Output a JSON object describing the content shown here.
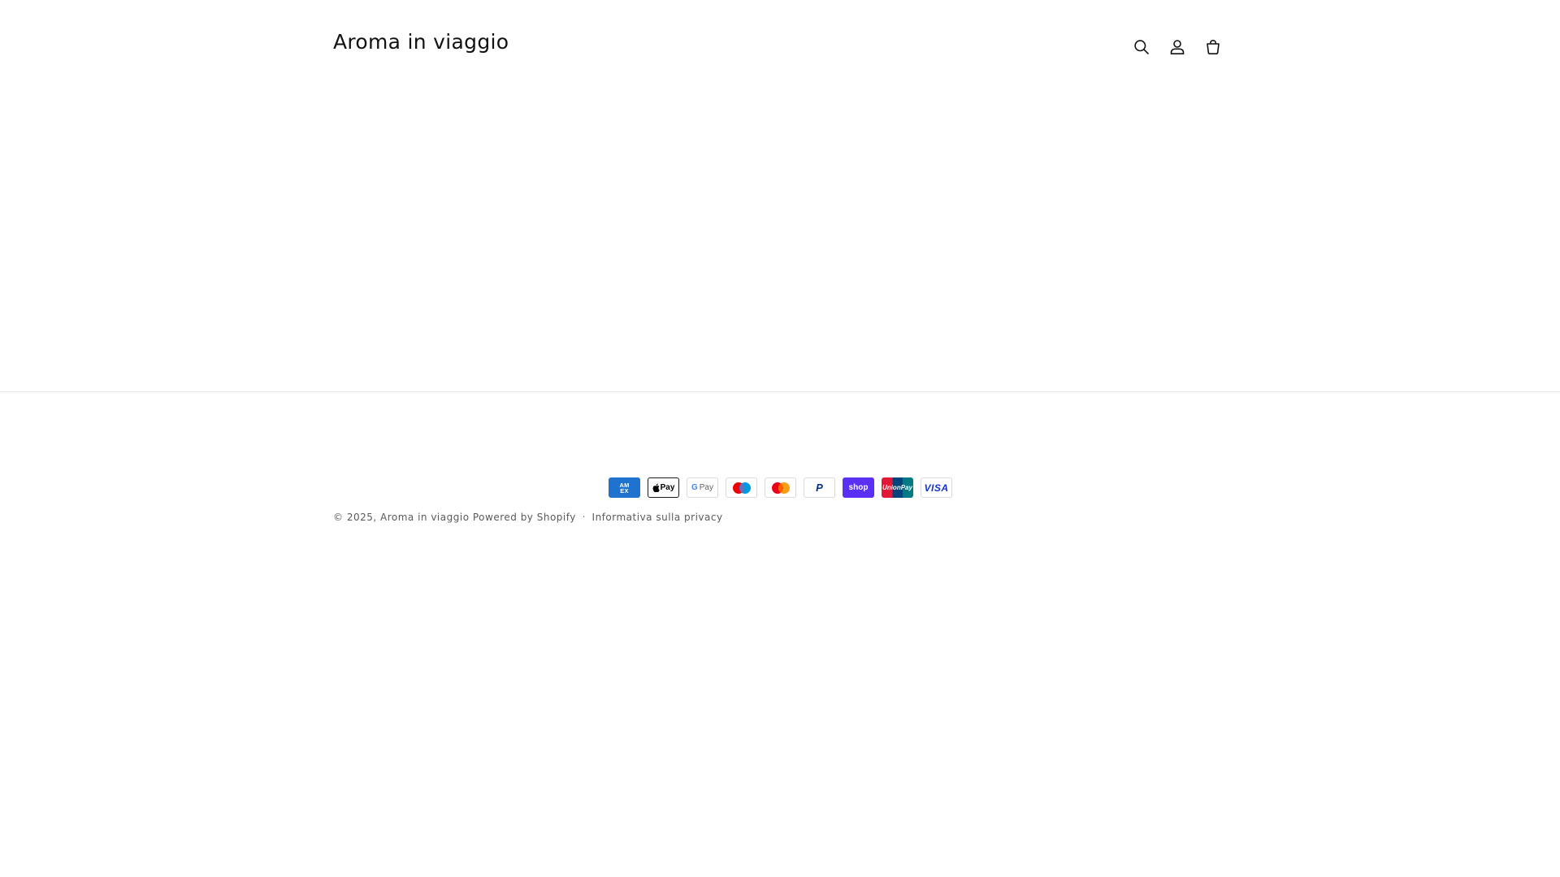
{
  "header": {
    "store_name": "Aroma in viaggio",
    "icons": [
      "search-icon",
      "account-icon",
      "cart-icon"
    ]
  },
  "footer": {
    "payment_methods": {
      "amex": {
        "line1": "AM",
        "line2": "EX"
      },
      "apple_pay": "Pay",
      "google_pay": {
        "g": "G",
        "label": "Pay"
      },
      "paypal": "P",
      "shop_pay": "shop",
      "unionpay": "UnionPay",
      "visa": "VISA"
    },
    "copyright_prefix": "© 2025,",
    "store_link": "Aroma in viaggio",
    "powered_by": "Powered by Shopify",
    "separator": "·",
    "privacy_link": "Informativa sulla privacy"
  },
  "colors": {
    "text": "#121212",
    "muted": "#5a5a5a",
    "divider": "#e8e8e8",
    "amex": "#1f72cd",
    "shop_pay": "#5a31f4",
    "visa": "#1434cb",
    "paypal": "#003087"
  }
}
